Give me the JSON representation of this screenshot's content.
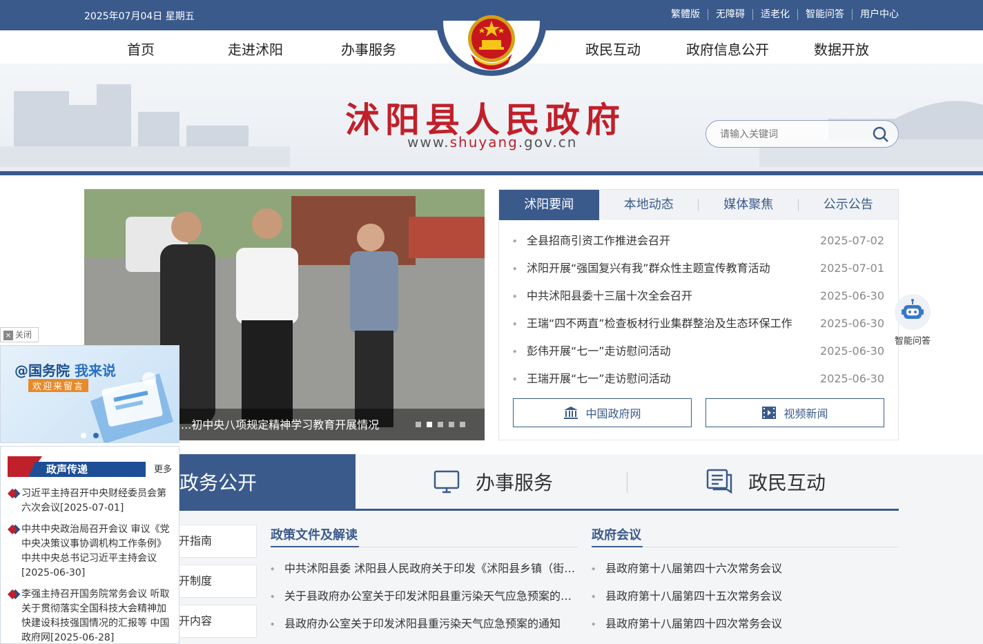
{
  "topbar": {
    "date": "2025年07月04日 星期五",
    "links": [
      "繁體版",
      "无障碍",
      "适老化",
      "智能问答",
      "用户中心"
    ]
  },
  "nav": [
    "首页",
    "走进沭阳",
    "办事服务",
    "政民互动",
    "政府信息公开",
    "数据开放"
  ],
  "header": {
    "title": "沭阳县人民政府",
    "url_prefix": "www.",
    "url_domain": "shuyang",
    "url_suffix": ".gov.cn",
    "search_placeholder": "请输入关键词"
  },
  "slider": {
    "caption": "...初中央八项规定精神学习教育开展情况",
    "active_index": 1,
    "count": 5
  },
  "news": {
    "tabs": [
      "沭阳要闻",
      "本地动态",
      "媒体聚焦",
      "公示公告"
    ],
    "active_tab": 0,
    "items": [
      {
        "title": "全县招商引资工作推进会召开",
        "date": "2025-07-02"
      },
      {
        "title": "沭阳开展“强国复兴有我”群众性主题宣传教育活动",
        "date": "2025-07-01"
      },
      {
        "title": "中共沭阳县委十三届十次全会召开",
        "date": "2025-06-30"
      },
      {
        "title": "王瑞“四不两直”检查板材行业集群整治及生态环保工作",
        "date": "2025-06-30"
      },
      {
        "title": "彭伟开展“七一”走访慰问活动",
        "date": "2025-06-30"
      },
      {
        "title": "王瑞开展“七一”走访慰问活动",
        "date": "2025-06-30"
      }
    ],
    "buttons": [
      "中国政府网",
      "视频新闻"
    ]
  },
  "robot": {
    "label": "智能问答"
  },
  "bigtabs": [
    "政务公开",
    "办事服务",
    "政民互动"
  ],
  "sidebtns": [
    "开指南",
    "开制度",
    "开内容"
  ],
  "policy": {
    "title": "政策文件及解读",
    "items": [
      "中共沭阳县委 沭阳县人民政府关于印发《沭阳县乡镇（街…",
      "关于县政府办公室关于印发沭阳县重污染天气应急预案的…",
      "县政府办公室关于印发沭阳县重污染天气应急预案的通知"
    ]
  },
  "meetings": {
    "title": "政府会议",
    "items": [
      "县政府第十八届第四十六次常务会议",
      "县政府第十八届第四十五次常务会议",
      "县政府第十八届第四十四次常务会议"
    ]
  },
  "float": {
    "close_label": "关闭",
    "ad_line1_a": "@国务院",
    "ad_line1_b": " 我来说",
    "ad_line2": "欢迎来留言",
    "news_title": "政声传递",
    "news_more": "更多",
    "news_items": [
      "习近平主持召开中央财经委员会第六次会议[2025-07-01]",
      "中共中央政治局召开会议 审议《党中央决策议事协调机构工作条例》 中共中央总书记习近平主持会议[2025-06-30]",
      "李强主持召开国务院常务会议 听取关于贯彻落实全国科技大会精神加快建设科技强国情况的汇报等 中国政府网[2025-06-28]"
    ]
  },
  "colors": {
    "primary": "#3a5a8c",
    "title_red": "#c0202a"
  }
}
